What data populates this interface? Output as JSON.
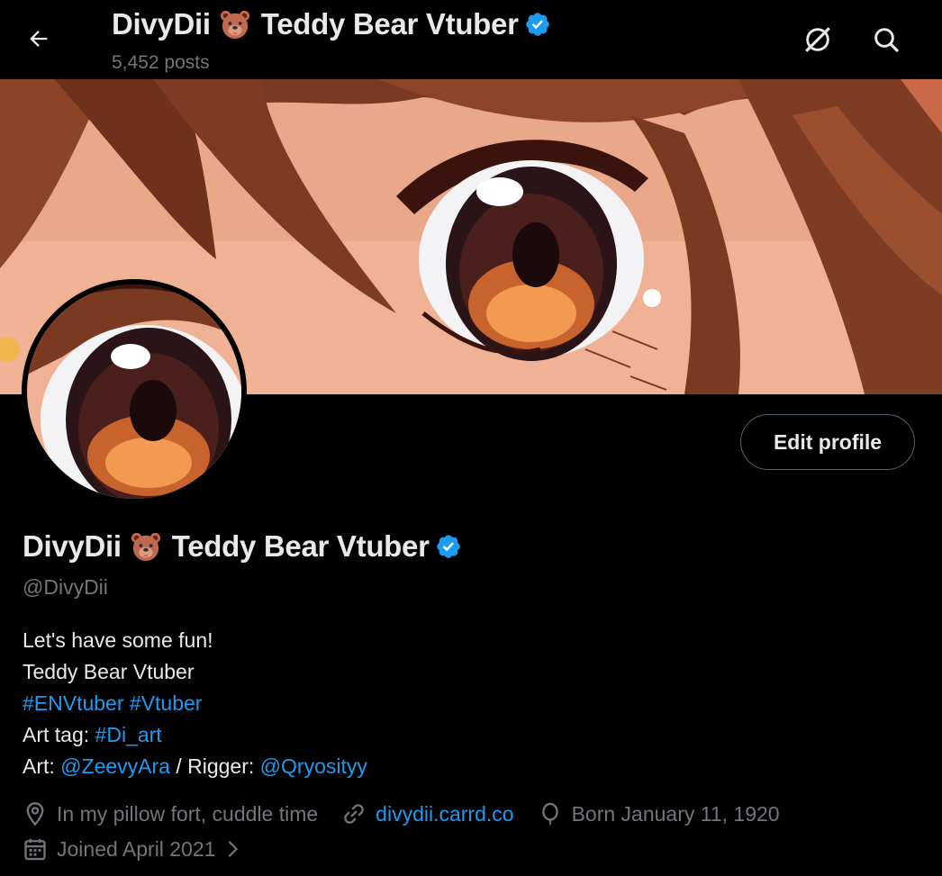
{
  "header": {
    "title_name": "DivyDii",
    "title_suffix": "Teddy Bear Vtuber",
    "posts": "5,452 posts"
  },
  "profile": {
    "name": "DivyDii",
    "name_suffix": "Teddy Bear Vtuber",
    "handle": "@DivyDii",
    "edit_label": "Edit profile"
  },
  "bio": {
    "line1": "Let's have some fun!",
    "line2": "Teddy Bear Vtuber",
    "hashtag1": "#ENVtuber",
    "hashtag2": "#Vtuber",
    "art_tag_label": "Art tag: ",
    "art_tag": "#Di_art",
    "art_label": "Art: ",
    "art_mention": "@ZeevyAra",
    "rigger_label": " / Rigger: ",
    "rigger_mention": "@Qryosityy"
  },
  "meta": {
    "location": "In my pillow fort, cuddle time",
    "website": "divydii.carrd.co",
    "birthday": "Born January 11, 1920",
    "joined": "Joined April 2021"
  },
  "colors": {
    "accent": "#1d9bf0",
    "muted": "#71767b",
    "text": "#e7e9ea",
    "background": "#000000"
  }
}
